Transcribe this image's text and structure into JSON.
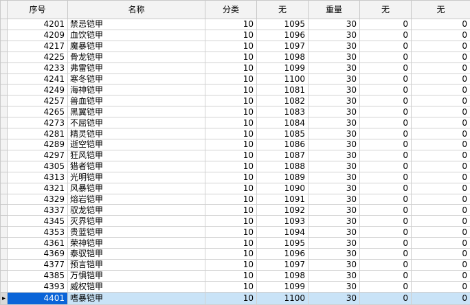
{
  "table": {
    "headers": [
      "序号",
      "名称",
      "分类",
      "无",
      "重量",
      "无",
      "无"
    ],
    "rows": [
      [
        "4201",
        "禁忌铠甲",
        "10",
        "1095",
        "30",
        "0",
        "0"
      ],
      [
        "4209",
        "血饮铠甲",
        "10",
        "1096",
        "30",
        "0",
        "0"
      ],
      [
        "4217",
        "魔暴铠甲",
        "10",
        "1097",
        "30",
        "0",
        "0"
      ],
      [
        "4225",
        "骨龙铠甲",
        "10",
        "1098",
        "30",
        "0",
        "0"
      ],
      [
        "4233",
        "弗雷铠甲",
        "10",
        "1099",
        "30",
        "0",
        "0"
      ],
      [
        "4241",
        "寒冬铠甲",
        "10",
        "1100",
        "30",
        "0",
        "0"
      ],
      [
        "4249",
        "海神铠甲",
        "10",
        "1081",
        "30",
        "0",
        "0"
      ],
      [
        "4257",
        "兽血铠甲",
        "10",
        "1082",
        "30",
        "0",
        "0"
      ],
      [
        "4265",
        "黑翼铠甲",
        "10",
        "1083",
        "30",
        "0",
        "0"
      ],
      [
        "4273",
        "不屈铠甲",
        "10",
        "1084",
        "30",
        "0",
        "0"
      ],
      [
        "4281",
        "精灵铠甲",
        "10",
        "1085",
        "30",
        "0",
        "0"
      ],
      [
        "4289",
        "逝空铠甲",
        "10",
        "1086",
        "30",
        "0",
        "0"
      ],
      [
        "4297",
        "狂风铠甲",
        "10",
        "1087",
        "30",
        "0",
        "0"
      ],
      [
        "4305",
        "猎者铠甲",
        "10",
        "1088",
        "30",
        "0",
        "0"
      ],
      [
        "4313",
        "光明铠甲",
        "10",
        "1089",
        "30",
        "0",
        "0"
      ],
      [
        "4321",
        "风暴铠甲",
        "10",
        "1090",
        "30",
        "0",
        "0"
      ],
      [
        "4329",
        "熔岩铠甲",
        "10",
        "1091",
        "30",
        "0",
        "0"
      ],
      [
        "4337",
        "驭龙铠甲",
        "10",
        "1092",
        "30",
        "0",
        "0"
      ],
      [
        "4345",
        "灭界铠甲",
        "10",
        "1093",
        "30",
        "0",
        "0"
      ],
      [
        "4353",
        "贵蓝铠甲",
        "10",
        "1094",
        "30",
        "0",
        "0"
      ],
      [
        "4361",
        "荣神铠甲",
        "10",
        "1095",
        "30",
        "0",
        "0"
      ],
      [
        "4369",
        "泰驭铠甲",
        "10",
        "1096",
        "30",
        "0",
        "0"
      ],
      [
        "4377",
        "预言铠甲",
        "10",
        "1097",
        "30",
        "0",
        "0"
      ],
      [
        "4385",
        "万惧铠甲",
        "10",
        "1098",
        "30",
        "0",
        "0"
      ],
      [
        "4393",
        "威权铠甲",
        "10",
        "1099",
        "30",
        "0",
        "0"
      ],
      [
        "4401",
        "嗜暴铠甲",
        "10",
        "1100",
        "30",
        "0",
        "0"
      ]
    ],
    "selected_row": 25,
    "colors": {
      "selection": "#0a64d8",
      "row_highlight": "#c9e3f7",
      "header": "#f3f3f3",
      "grid_line": "#d0d0d0"
    },
    "icons": {
      "current_row_indicator": "row-pointer-icon"
    }
  }
}
